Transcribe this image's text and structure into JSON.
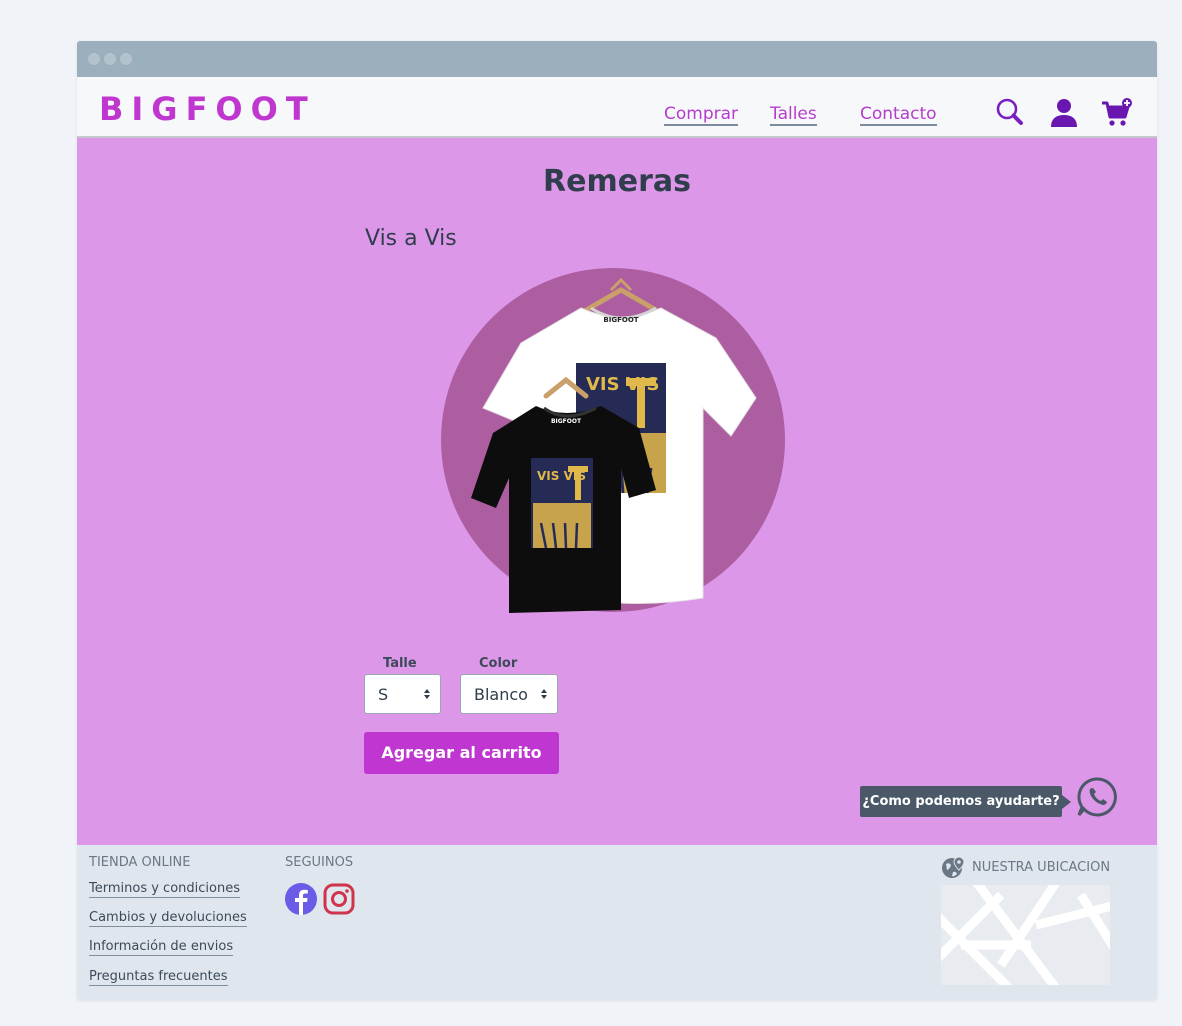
{
  "header": {
    "logo": "BIGFOOT",
    "nav": [
      "Comprar",
      "Talles",
      "Contacto"
    ],
    "icons": [
      "search-icon",
      "user-icon",
      "cart-add-icon"
    ]
  },
  "main": {
    "title": "Remeras",
    "product_name": "Vis a Vis",
    "talle_label": "Talle",
    "talle_value": "S",
    "color_label": "Color",
    "color_value": "Blanco",
    "add_button": "Agregar al carrito",
    "help_text": "¿Como podemos ayudarte?",
    "tshirt_brand": "BIGFOOT",
    "print_text": "VIS VIS"
  },
  "footer": {
    "tienda_heading": "TIENDA ONLINE",
    "links": [
      "Terminos y condiciones",
      "Cambios y devoluciones",
      "Información de envios",
      "Preguntas frecuentes"
    ],
    "seguinos_heading": "SEGUINOS",
    "ubicacion_heading": "NUESTRA UBICACION"
  },
  "colors": {
    "brand": "#c037cf",
    "main_bg": "#dd97e8",
    "circle": "#ad5ea1",
    "footer_bg": "#e0e6ed",
    "text_dark": "#2f3d4c"
  }
}
